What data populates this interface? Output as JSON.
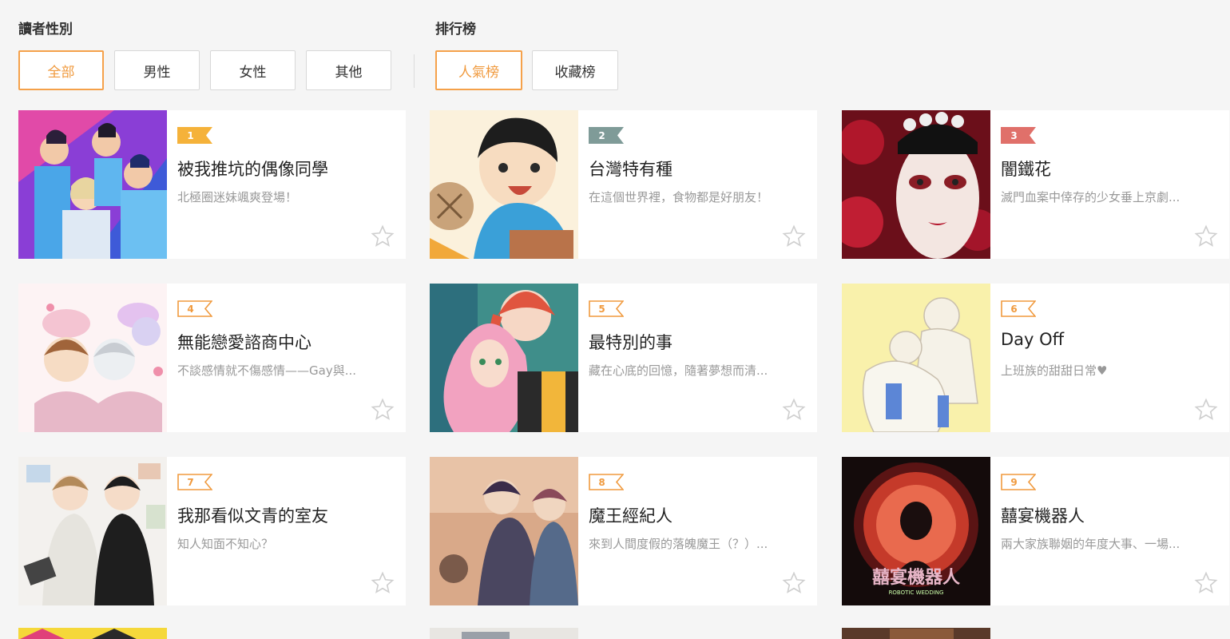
{
  "filters": {
    "gender_label": "讀者性別",
    "gender_options": [
      "全部",
      "男性",
      "女性",
      "其他"
    ],
    "ranking_label": "排行榜",
    "ranking_options": [
      "人氣榜",
      "收藏榜"
    ]
  },
  "colors": {
    "accent": "#f09a3e",
    "rank1": "#f5b23a",
    "rank2": "#7f9b98",
    "rank3": "#e0706a",
    "rank_outline": "#f09a3e"
  },
  "comics": [
    {
      "rank": "1",
      "title": "被我推坑的偶像同學",
      "desc": "北極圈迷妹颯爽登場！",
      "icon": "star-icon"
    },
    {
      "rank": "2",
      "title": "台灣特有種",
      "desc": "在這個世界裡，食物都是好朋友！",
      "icon": "star-icon"
    },
    {
      "rank": "3",
      "title": "闇鐵花",
      "desc": "滅門血案中倖存的少女垂上京劇...",
      "icon": "star-icon"
    },
    {
      "rank": "4",
      "title": "無能戀愛諮商中心",
      "desc": "不談感情就不傷感情——Gay與...",
      "icon": "star-icon"
    },
    {
      "rank": "5",
      "title": "最特別的事",
      "desc": "藏在心底的回憶，隨著夢想而清...",
      "icon": "star-icon"
    },
    {
      "rank": "6",
      "title": "Day Off",
      "desc": "上班族的甜甜日常♥",
      "icon": "star-icon"
    },
    {
      "rank": "7",
      "title": "我那看似文青的室友",
      "desc": "知人知面不知心？",
      "icon": "star-icon"
    },
    {
      "rank": "8",
      "title": "魔王經紀人",
      "desc": "來到人間度假的落魄魔王（？）...",
      "icon": "star-icon"
    },
    {
      "rank": "9",
      "title": "囍宴機器人",
      "desc": "兩大家族聯姻的年度大事、一場...",
      "icon": "star-icon"
    }
  ],
  "cover_text": {
    "cover9": "囍宴機器人",
    "cover9_sub": "ROBOTIC WEDDING"
  }
}
